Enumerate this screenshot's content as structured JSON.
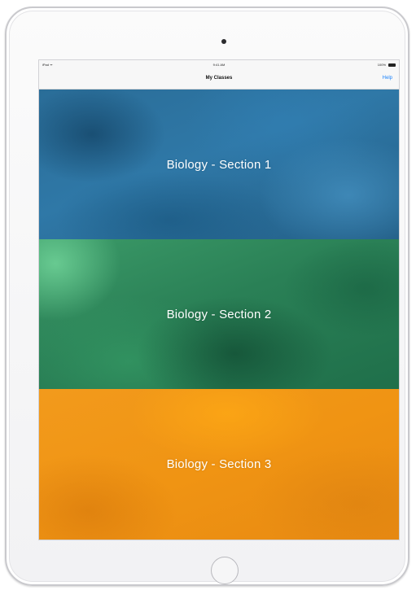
{
  "status_bar": {
    "carrier": "iPad ᯤ",
    "time": "9:41 AM",
    "battery": "100%"
  },
  "nav": {
    "title": "My Classes",
    "help_label": "Help"
  },
  "classes": [
    {
      "label": "Biology - Section 1",
      "color": "#2b6e9b"
    },
    {
      "label": "Biology - Section 2",
      "color": "#2e8458"
    },
    {
      "label": "Biology - Section 3",
      "color": "#f19517"
    }
  ],
  "icons": {
    "camera": "camera-icon",
    "home": "home-button",
    "battery": "battery-icon"
  }
}
